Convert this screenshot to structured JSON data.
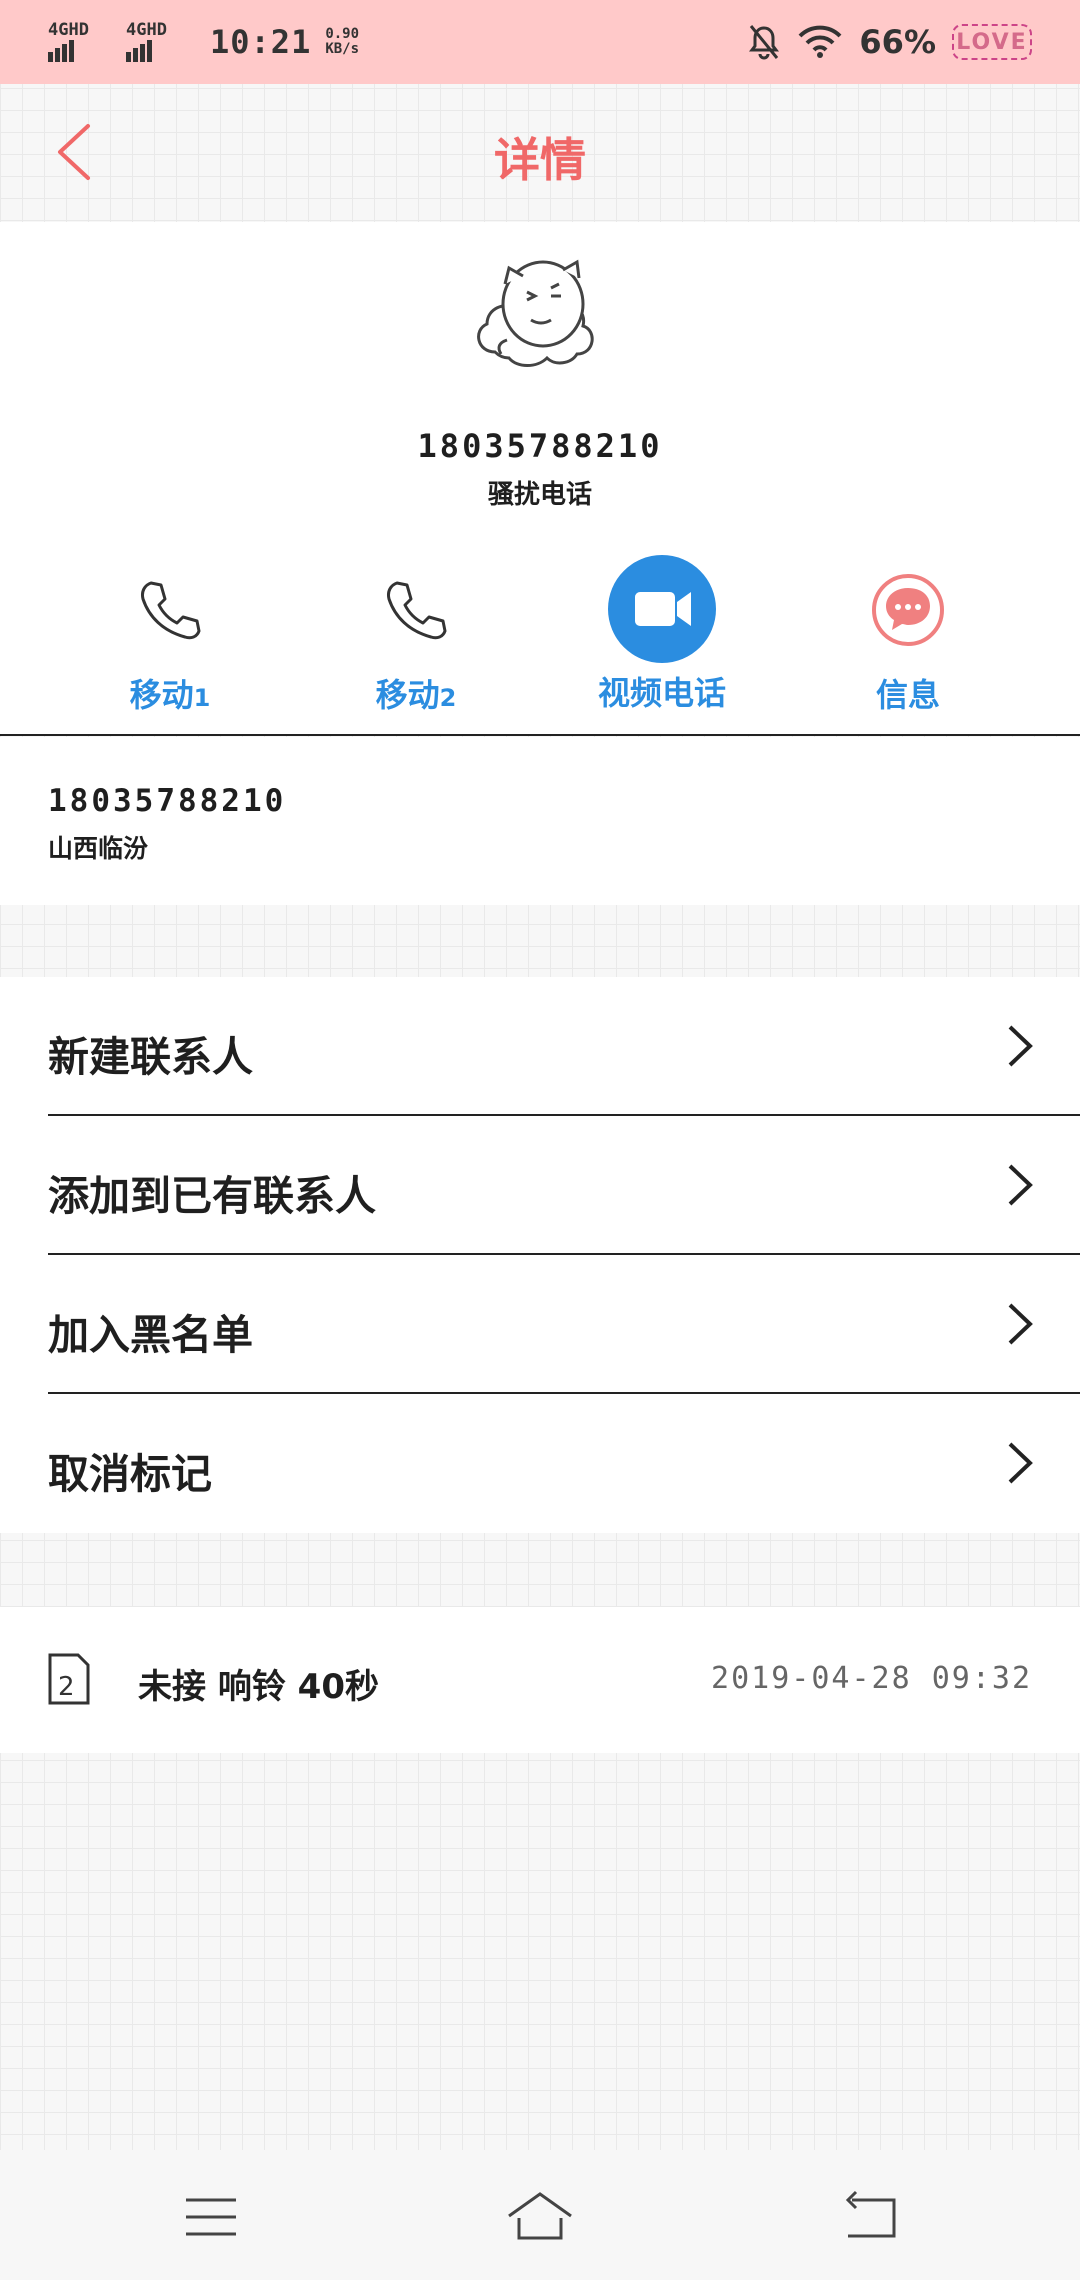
{
  "status_bar": {
    "sim1": "4GHD",
    "sim2": "4GHD",
    "time": "10:21",
    "speed_value": "0.90",
    "speed_unit": "KB/s",
    "battery": "66%",
    "battery_theme": "LOVE"
  },
  "header": {
    "title": "详情",
    "back_icon": "chevron-left-icon"
  },
  "profile": {
    "avatar_icon": "cat-avatar-icon",
    "phone": "18035788210",
    "tag": "骚扰电话"
  },
  "actions": [
    {
      "label": "移动",
      "sub": "1",
      "icon": "phone-icon"
    },
    {
      "label": "移动",
      "sub": "2",
      "icon": "phone-icon"
    },
    {
      "label": "视频电话",
      "icon": "video-icon"
    },
    {
      "label": "信息",
      "icon": "message-icon"
    }
  ],
  "number_info": {
    "phone": "18035788210",
    "location": "山西临汾"
  },
  "options": [
    {
      "label": "新建联系人"
    },
    {
      "label": "添加到已有联系人"
    },
    {
      "label": "加入黑名单"
    },
    {
      "label": "取消标记"
    }
  ],
  "call_log": {
    "sim": "2",
    "status": "未接 响铃 40秒",
    "time": "2019-04-28 09:32"
  },
  "colors": {
    "accent": "#f06868",
    "action_blue": "#2b8de0",
    "status_bar": "#ffc9c9",
    "message_pink": "#f08080"
  },
  "navbar": {
    "icons": [
      "menu-icon",
      "home-icon",
      "back-icon"
    ]
  }
}
